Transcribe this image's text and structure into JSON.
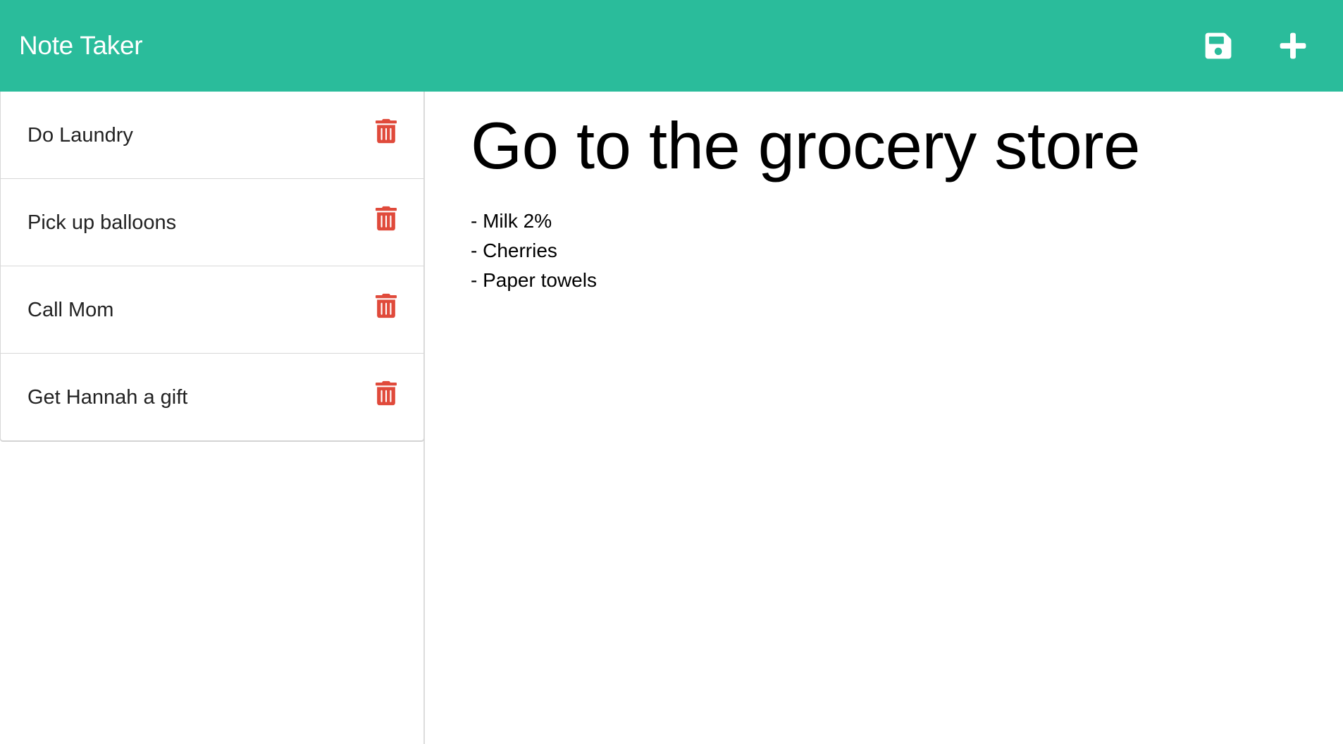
{
  "app": {
    "brand": "Note Taker"
  },
  "colors": {
    "navbar_bg": "#2abc9b",
    "delete_icon": "#e04a3b",
    "nav_icon": "#ffffff"
  },
  "toolbar": {
    "save_icon": "floppy-disk",
    "new_icon": "plus"
  },
  "notes": [
    {
      "title": "Do Laundry",
      "delete_icon": "trash"
    },
    {
      "title": "Pick up balloons",
      "delete_icon": "trash"
    },
    {
      "title": "Call Mom",
      "delete_icon": "trash"
    },
    {
      "title": "Get Hannah a gift",
      "delete_icon": "trash"
    }
  ],
  "active_note": {
    "title": "Go to the grocery store",
    "lines": [
      "- Milk 2%",
      "- Cherries",
      "- Paper towels"
    ]
  }
}
